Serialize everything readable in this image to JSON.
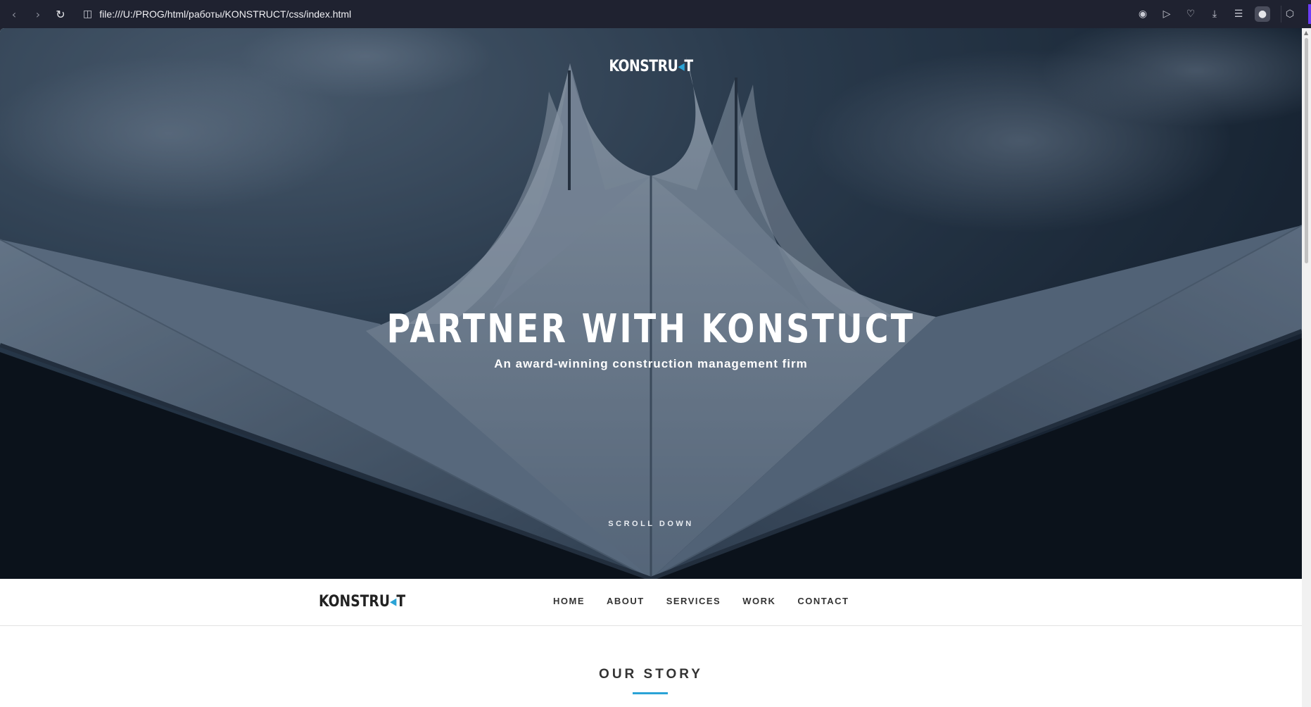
{
  "browser": {
    "url": "file:///U:/PROG/html/работы/KONSTRUCT/css/index.html",
    "icons": {
      "back": "back-arrow-icon",
      "forward": "forward-arrow-icon",
      "reload": "reload-icon",
      "page": "document-icon",
      "camera": "camera-icon",
      "play": "play-icon",
      "favorite": "heart-icon",
      "download": "download-icon",
      "menu": "menu-icon",
      "profile": "profile-icon",
      "extension": "cube-icon"
    }
  },
  "hero": {
    "logo_main": "KONSTRU",
    "logo_accent": "◂",
    "logo_end": "T",
    "headline": "PARTNER WITH KONSTUCT",
    "subtitle": "An award-winning construction management firm",
    "scroll_label": "SCROLL DOWN"
  },
  "navbar": {
    "logo_main": "KONSTRU",
    "logo_accent": "◂",
    "logo_end": "T",
    "items": [
      "HOME",
      "ABOUT",
      "SERVICES",
      "WORK",
      "CONTACT"
    ]
  },
  "story": {
    "title": "OUR STORY"
  },
  "colors": {
    "accent": "#2aa3d6",
    "chrome_bg": "#1f2230",
    "text_dark": "#333333"
  }
}
